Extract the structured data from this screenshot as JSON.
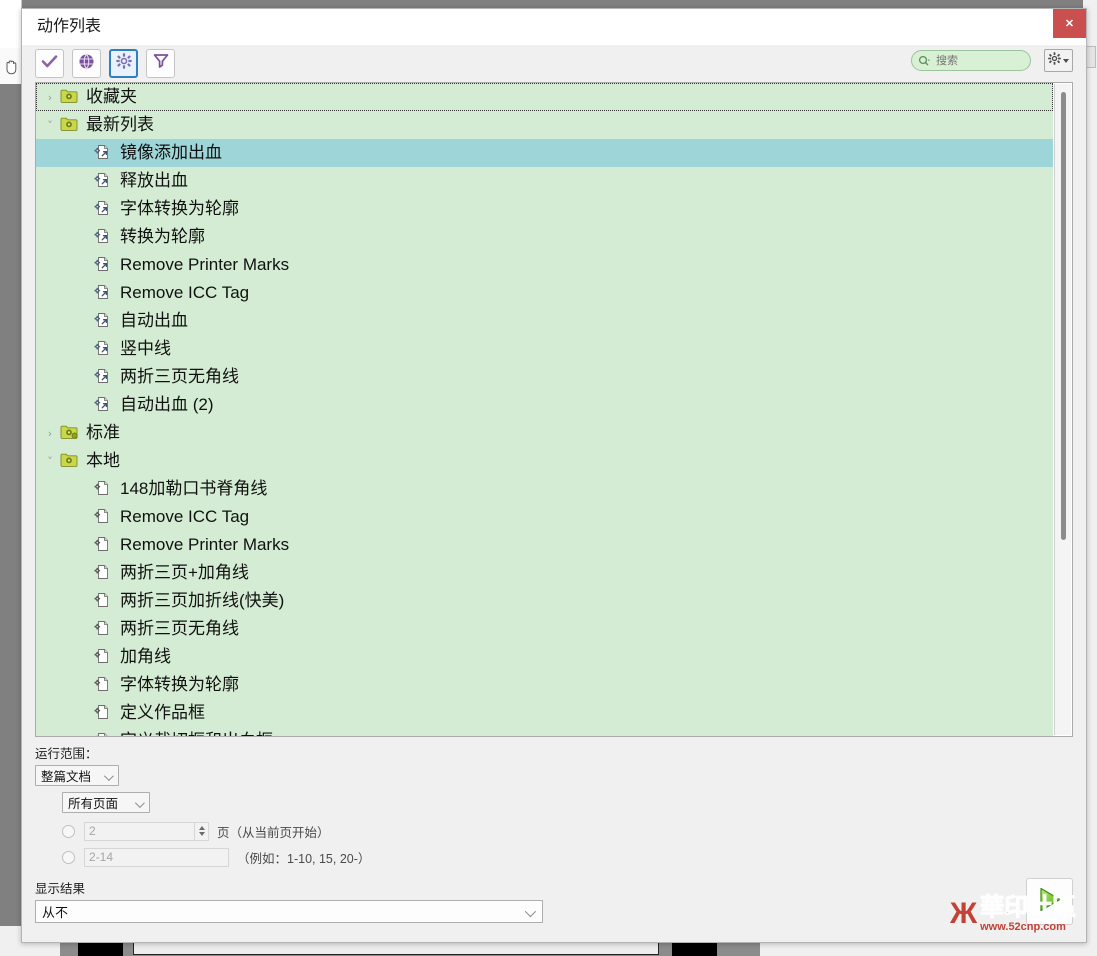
{
  "window": {
    "title": "动作列表",
    "close_label": "✕"
  },
  "toolbar": {
    "buttons": [
      {
        "name": "check-icon",
        "title": "检查",
        "active": false
      },
      {
        "name": "globe-icon",
        "title": "在线",
        "active": false
      },
      {
        "name": "gear-icon",
        "title": "设置",
        "active": true
      },
      {
        "name": "filter-icon",
        "title": "筛选",
        "active": false
      }
    ],
    "search": {
      "placeholder": "搜索",
      "value": ""
    },
    "gear_menu_label": "▾"
  },
  "tree": {
    "groups": [
      {
        "label": "收藏夹",
        "expanded": false,
        "chevron": "›",
        "icon": "folder-gear-icon",
        "focused": true,
        "items": []
      },
      {
        "label": "最新列表",
        "expanded": true,
        "chevron": "˅",
        "icon": "folder-gear-icon",
        "focused": false,
        "items": [
          {
            "label": "镜像添加出血",
            "icon": "action-link-icon",
            "selected": true
          },
          {
            "label": "释放出血",
            "icon": "action-link-icon",
            "selected": false
          },
          {
            "label": "字体转换为轮廓",
            "icon": "action-link-icon",
            "selected": false
          },
          {
            "label": "转换为轮廓",
            "icon": "action-link-icon",
            "selected": false
          },
          {
            "label": "Remove Printer Marks",
            "icon": "action-link-icon",
            "selected": false
          },
          {
            "label": "Remove ICC Tag",
            "icon": "action-link-icon",
            "selected": false
          },
          {
            "label": "自动出血",
            "icon": "action-link-icon",
            "selected": false
          },
          {
            "label": "竖中线",
            "icon": "action-link-icon",
            "selected": false
          },
          {
            "label": "两折三页无角线",
            "icon": "action-link-icon",
            "selected": false
          },
          {
            "label": "自动出血 (2)",
            "icon": "action-link-icon",
            "selected": false
          }
        ]
      },
      {
        "label": "标准",
        "expanded": false,
        "chevron": "›",
        "icon": "folder-gear-badge-icon",
        "focused": false,
        "items": []
      },
      {
        "label": "本地",
        "expanded": true,
        "chevron": "˅",
        "icon": "folder-gear-icon",
        "focused": false,
        "items": [
          {
            "label": "148加勒口书脊角线",
            "icon": "action-icon",
            "selected": false
          },
          {
            "label": "Remove ICC Tag",
            "icon": "action-icon",
            "selected": false
          },
          {
            "label": "Remove Printer Marks",
            "icon": "action-icon",
            "selected": false
          },
          {
            "label": "两折三页+加角线",
            "icon": "action-icon",
            "selected": false
          },
          {
            "label": "两折三页加折线(快美)",
            "icon": "action-icon",
            "selected": false
          },
          {
            "label": "两折三页无角线",
            "icon": "action-icon",
            "selected": false
          },
          {
            "label": "加角线",
            "icon": "action-icon",
            "selected": false
          },
          {
            "label": "字体转换为轮廓",
            "icon": "action-icon",
            "selected": false
          },
          {
            "label": "定义作品框",
            "icon": "action-icon",
            "selected": false
          },
          {
            "label": "定义裁切框和出血框",
            "icon": "action-icon",
            "selected": false
          }
        ]
      }
    ]
  },
  "options": {
    "scope_label": "运行范围：",
    "scope_value": "整篇文档",
    "pages_value": "所有页面",
    "page_from_value": "2",
    "page_from_hint": "页（从当前页开始）",
    "page_range_value": "2-14",
    "page_range_hint": "（例如：1-10, 15, 20-）",
    "result_label": "显示结果",
    "result_value": "从不"
  },
  "run_button": {
    "name": "run-play-button",
    "title": "运行"
  },
  "watermark": {
    "logo": "Ж",
    "text": "華印社區",
    "url": "www.52cnp.com"
  },
  "colors": {
    "tree_bg": "#d4ecd3",
    "selection": "#9ed5d8",
    "accent": "#2f7fc4",
    "close": "#c9504f",
    "run_green": "#8fd24a"
  }
}
